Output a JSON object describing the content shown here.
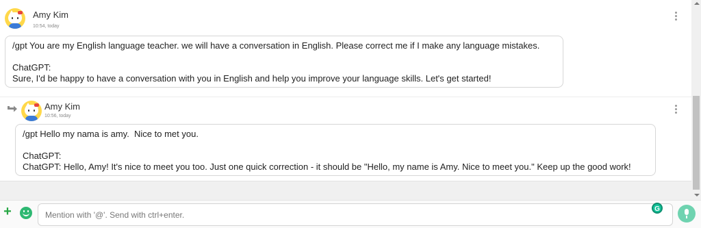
{
  "messages": [
    {
      "author": "Amy Kim",
      "time": "10:54, today",
      "lines": [
        "/gpt You are my English language teacher. we will have a conversation in English. Please correct me if I make any language mistakes.",
        "ChatGPT:",
        "Sure, I'd be happy to have a conversation with you in English and help you improve your language skills. Let's get started!"
      ]
    },
    {
      "author": "Amy Kim",
      "time": "10:56, today",
      "lines": [
        "/gpt Hello my nama is amy.  Nice to met you.",
        "ChatGPT:",
        "ChatGPT: Hello, Amy! It's nice to meet you too. Just one quick correction - it should be \"Hello, my name is Amy. Nice to meet you.\" Keep up the good work!"
      ]
    }
  ],
  "composer": {
    "placeholder": "Mention with '@'. Send with ctrl+enter.",
    "grammarly_letter": "G"
  },
  "icons": {
    "reply": "reply-arrow-icon",
    "more": "more-vertical-icon",
    "add": "plus-icon",
    "emoji": "emoji-icon",
    "mic": "microphone-icon",
    "grammarly": "grammarly-icon"
  },
  "colors": {
    "accent_green": "#28a745",
    "emoji_green": "#2eb872",
    "grammarly": "#15c39a",
    "mic": "#6fd3b0"
  }
}
